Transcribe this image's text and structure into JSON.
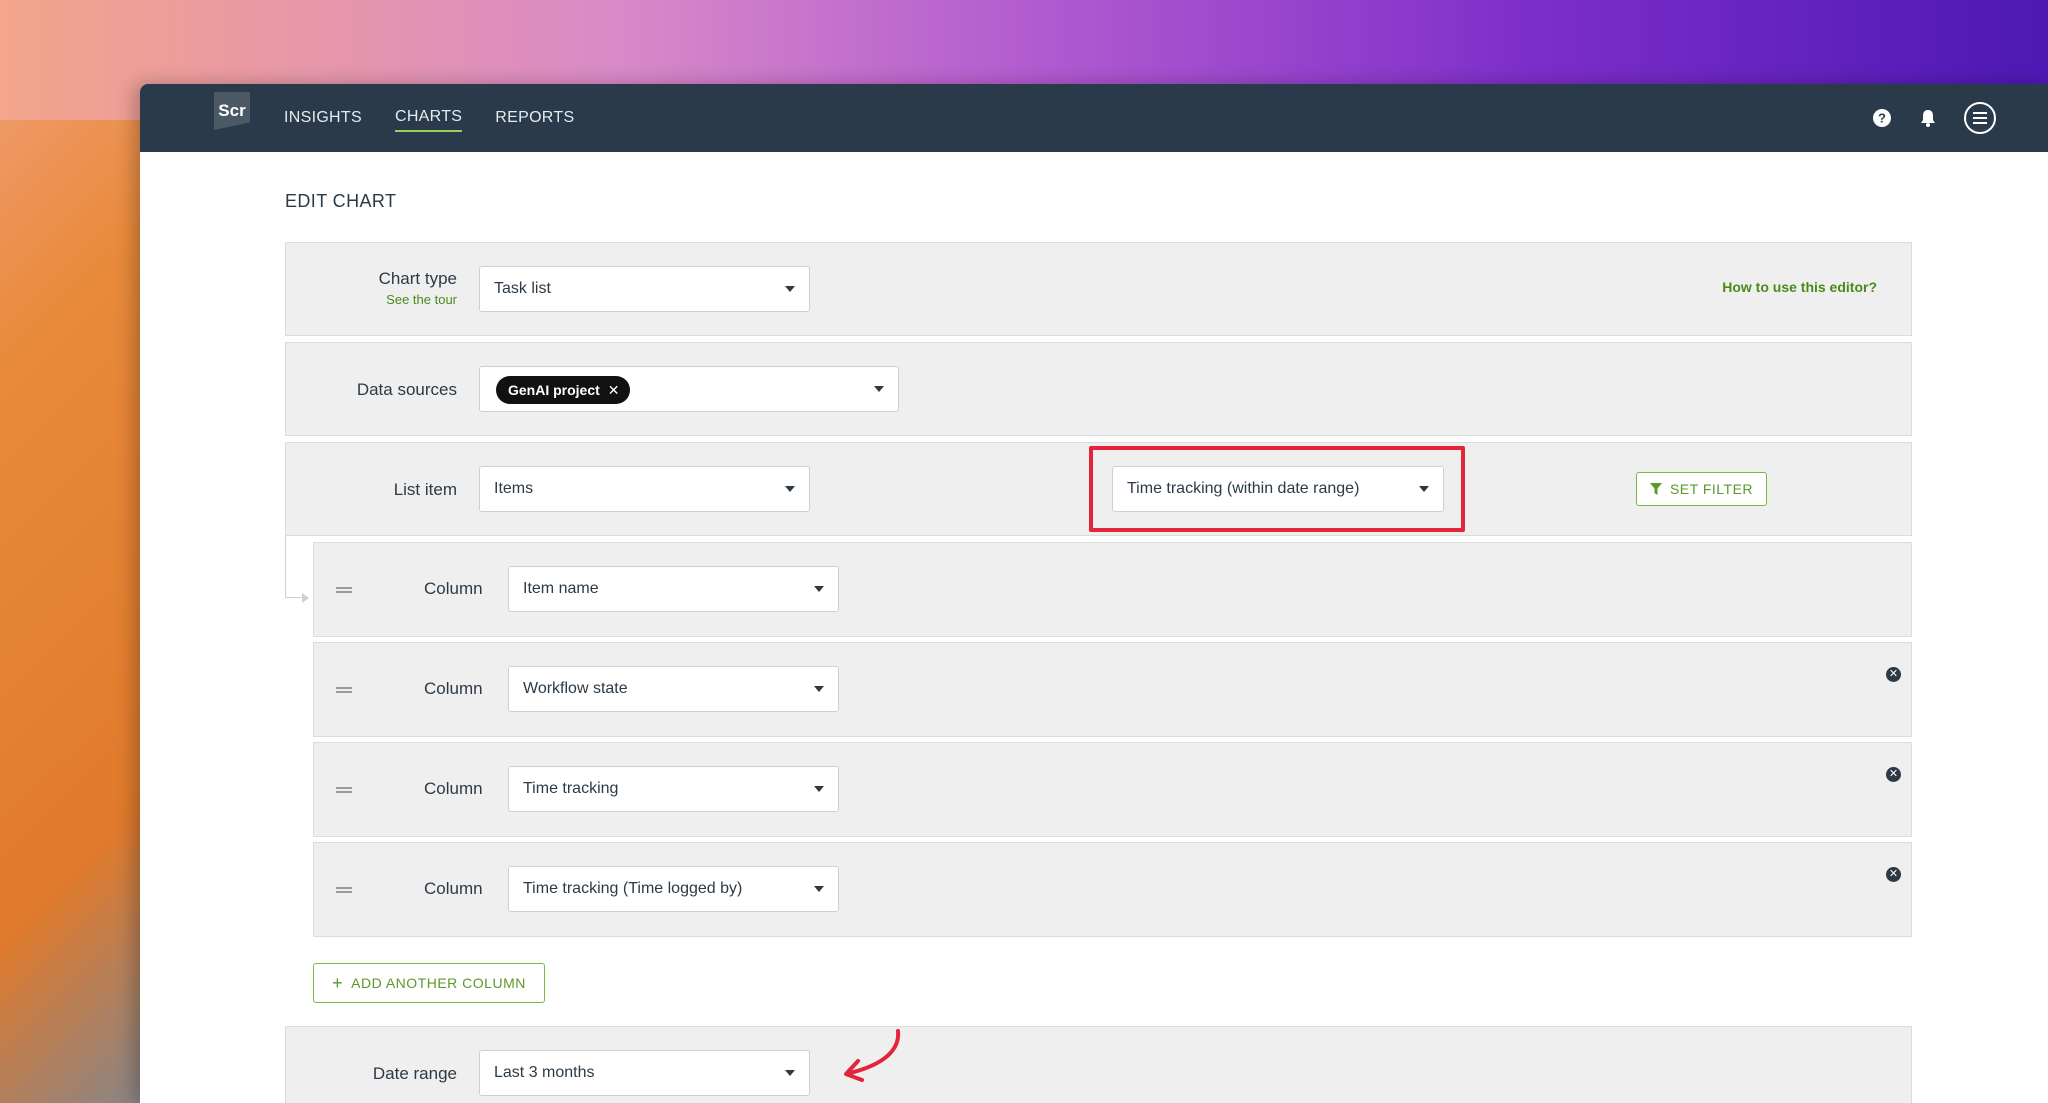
{
  "app": {
    "logo_text": "Scr"
  },
  "nav": {
    "items": [
      {
        "label": "INSIGHTS",
        "active": false
      },
      {
        "label": "CHARTS",
        "active": true
      },
      {
        "label": "REPORTS",
        "active": false
      }
    ]
  },
  "topbar_icons": [
    "help-icon",
    "bell-icon",
    "menu-icon"
  ],
  "page": {
    "title": "EDIT CHART"
  },
  "chart_type": {
    "label": "Chart type",
    "sublink": "See the tour",
    "value": "Task list",
    "help_link": "How to use this editor?"
  },
  "data_sources": {
    "label": "Data sources",
    "chip": "GenAI project"
  },
  "list_item": {
    "label": "List item",
    "value": "Items",
    "time_value": "Time tracking (within date range)",
    "filter_button": "SET FILTER"
  },
  "columns": [
    {
      "label": "Column",
      "value": "Item name",
      "removable": false
    },
    {
      "label": "Column",
      "value": "Workflow state",
      "removable": true
    },
    {
      "label": "Column",
      "value": "Time tracking",
      "removable": true
    },
    {
      "label": "Column",
      "value": "Time tracking (Time logged by)",
      "removable": true
    }
  ],
  "add_column_button": "ADD ANOTHER COLUMN",
  "date_range": {
    "label": "Date range",
    "value": "Last 3 months"
  },
  "colors": {
    "topbar": "#2a3a4a",
    "accent_green": "#5a9a2a",
    "highlight_red": "#e2253a",
    "panel_bg": "#efefef"
  }
}
